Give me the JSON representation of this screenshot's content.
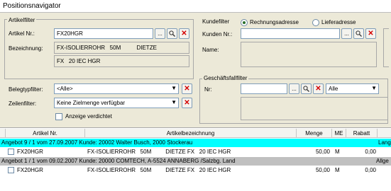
{
  "window": {
    "title": "Positionsnavigator"
  },
  "artikelfilter": {
    "legend": "Artikelfilter",
    "artikel_nr_label": "Artikel Nr.:",
    "artikel_nr_value": "FX20HGR",
    "bezeichnung_label": "Bezeichnung:",
    "bezeichnung_line1": "FX-ISOLIERROHR   50M          DIETZE",
    "bezeichnung_line2": "FX   20 IEC HGR"
  },
  "kundenfilter": {
    "legend": "Kundefilter",
    "radio_rechnung": "Rechnungsadresse",
    "radio_liefer": "Lieferadresse",
    "selected": "Rechnungsadresse",
    "kunden_nr_label": "Kunden Nr.:",
    "kunden_nr_value": "",
    "name_label": "Name:"
  },
  "beleg": {
    "belegtyp_label": "Belegtypfilter:",
    "belegtyp_value": "<Alle>",
    "zeilen_label": "Zeilenfilter:",
    "zeilen_value": "Keine Zielmenge verfügbar",
    "verdichtet_label": "Anzeige verdichtet",
    "verdichtet_checked": false
  },
  "geschaeftsfall": {
    "legend": "Geschäftsfallfilter",
    "nr_label": "Nr:",
    "nr_value": "",
    "type_value": "Alle"
  },
  "buttons": {
    "browse": "...",
    "lookup_icon": "magnifier-icon",
    "clear": "✕"
  },
  "grid": {
    "columns": [
      "Artikel Nr.",
      "Artikelbezeichnung",
      "Menge",
      "ME",
      "Rabatt"
    ],
    "groups": [
      {
        "header": "Angebot 9 / 1 vom 27.09.2007  Kunde: 20002 Walter Busch, 2000  Stockerau",
        "right": "Lang",
        "color": "#00ffff",
        "row": {
          "artikel": "FX20HGR",
          "bez": "FX-ISOLIERROHR   50M         DIETZE FX   20 IEC HGR",
          "menge": "50,00",
          "me": "M",
          "rabatt": "0,00"
        }
      },
      {
        "header": "Angebot 1 / 1 vom 09.02.2007  Kunde: 20000 COMTECH, A-5524 ANNABERG /Salzbg. Land",
        "right": "Allge",
        "color": "#c0c0c0",
        "row": {
          "artikel": "FX20HGR",
          "bez": "FX-ISOLIERROHR   50M         DIETZE FX   20 IEC HGR",
          "menge": "50,00",
          "me": "M",
          "rabatt": "0,00"
        }
      }
    ]
  }
}
